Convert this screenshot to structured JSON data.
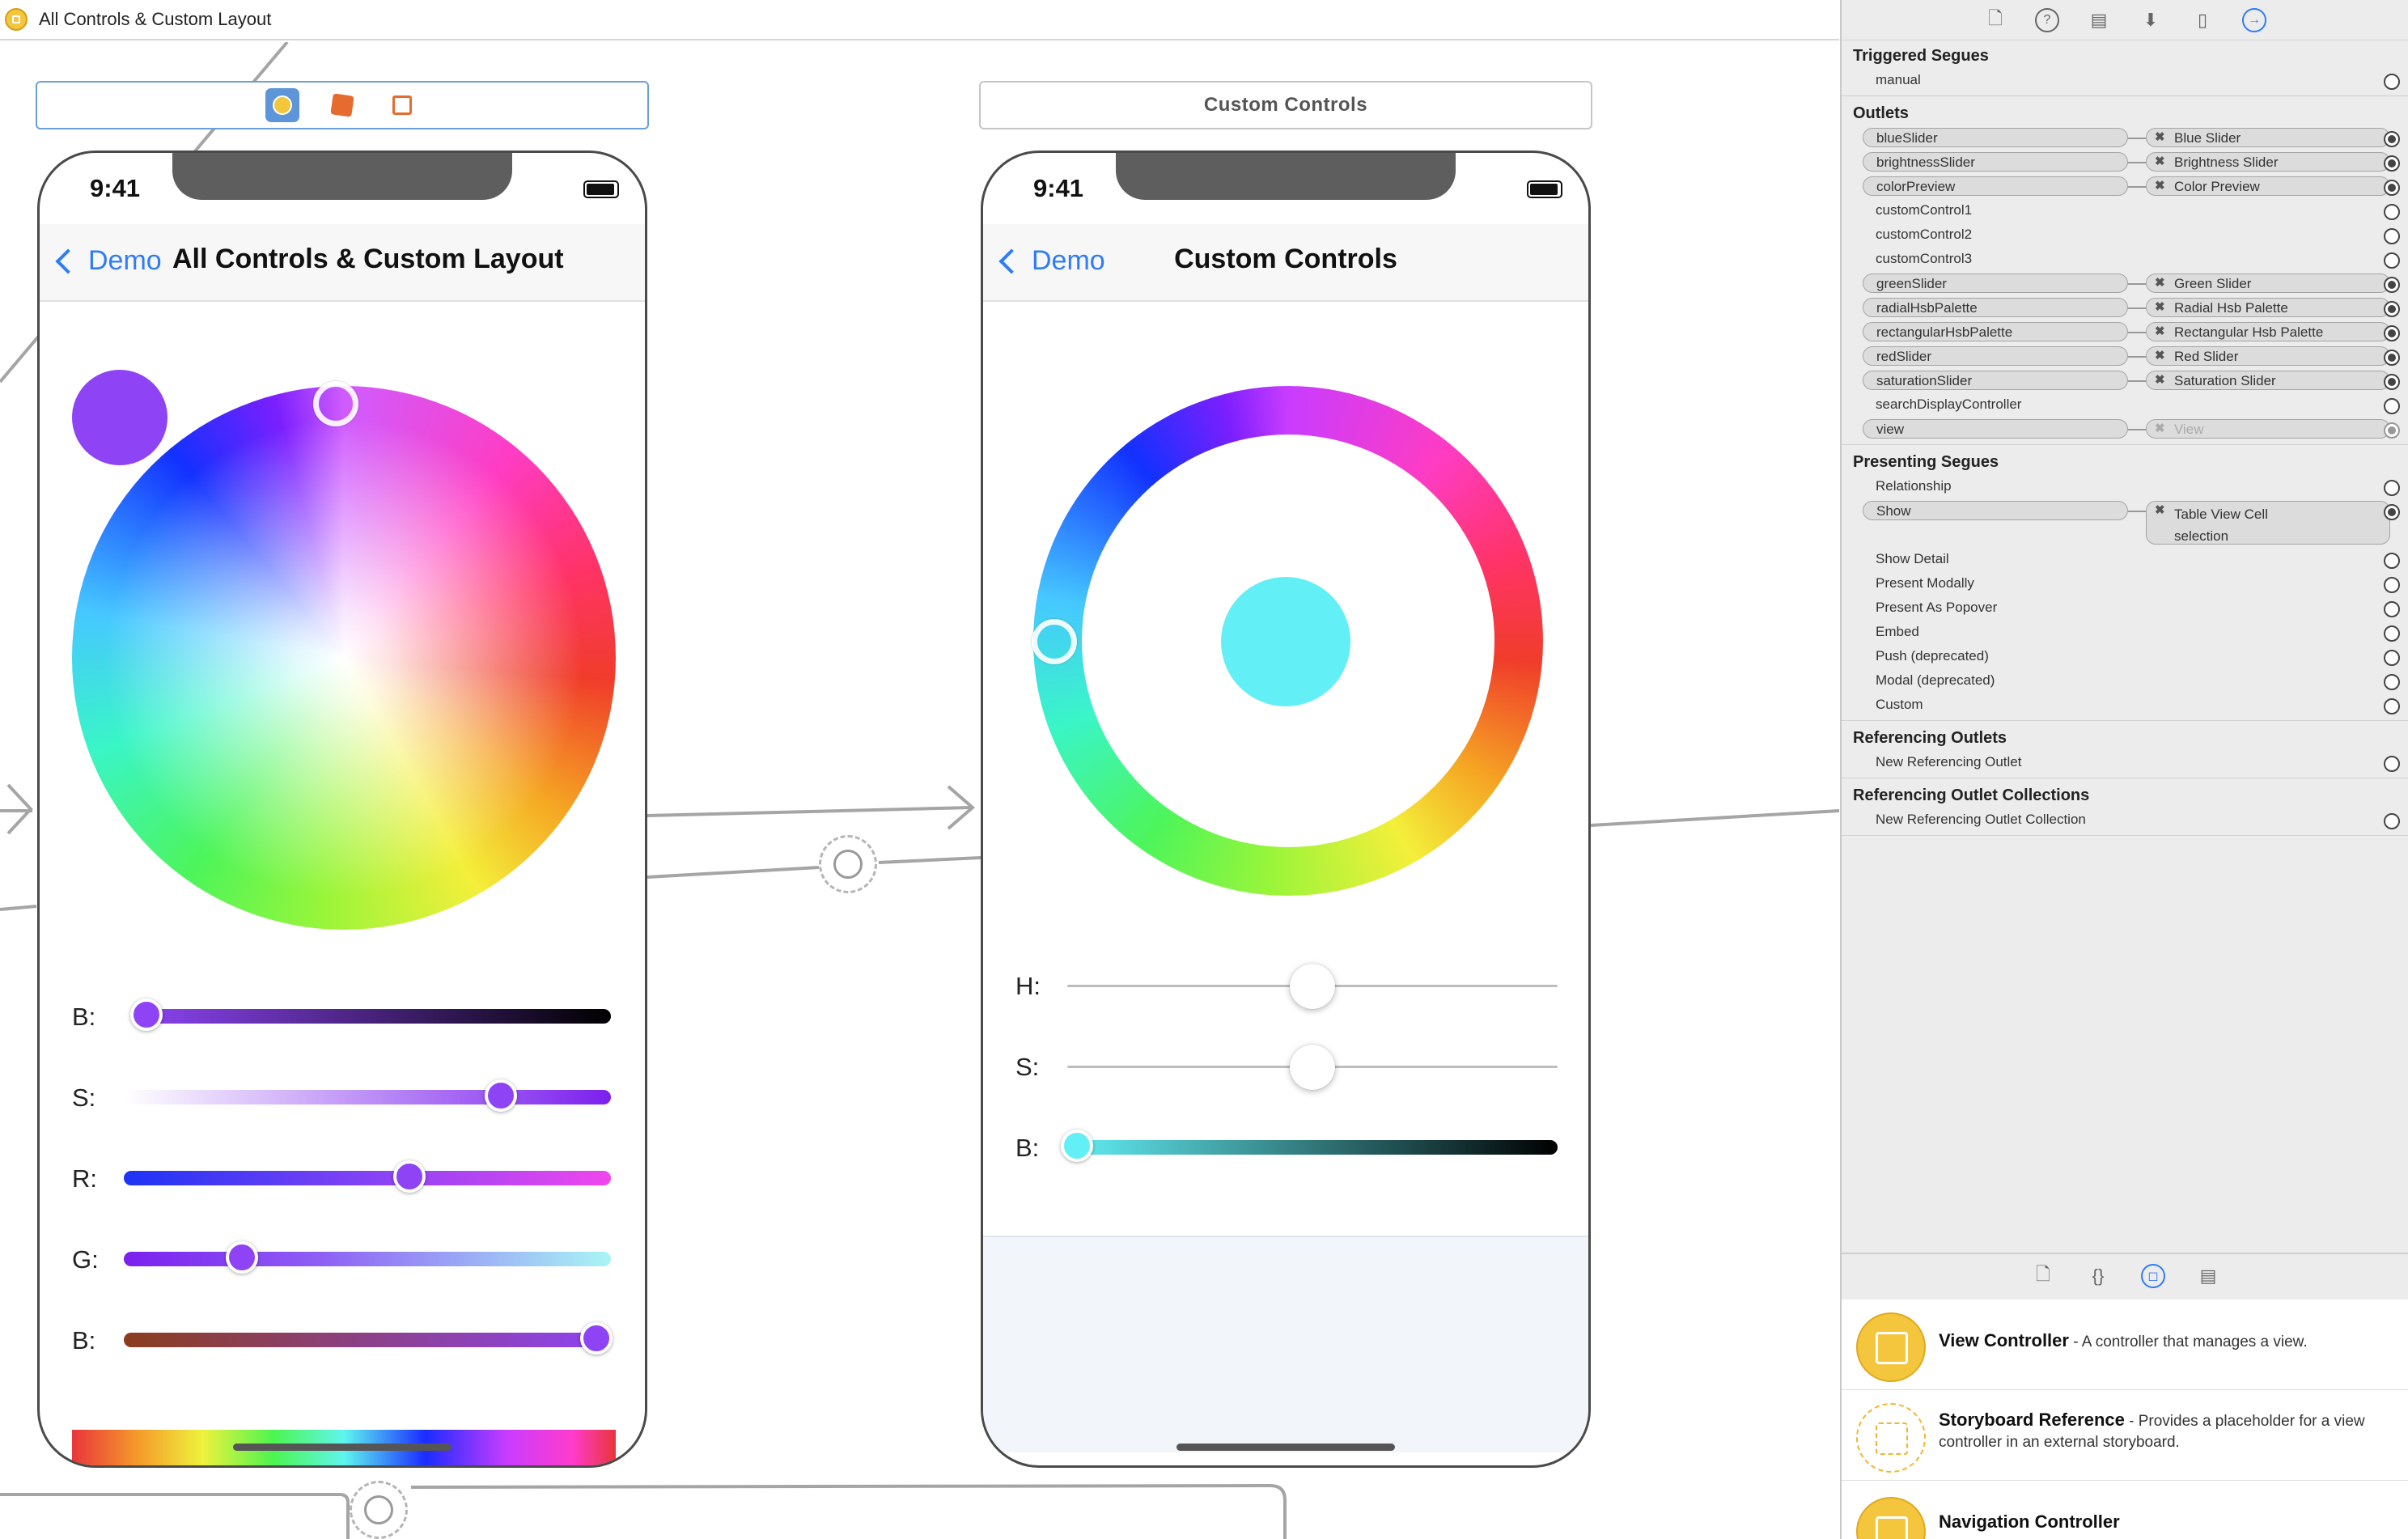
{
  "window": {
    "title": "All Controls & Custom Layout"
  },
  "scene1": {
    "back_label": "Demo",
    "nav_title": "All Controls & Custom Layout",
    "time": "9:41",
    "sliders": [
      {
        "label": "B:",
        "value": 0.03
      },
      {
        "label": "S:",
        "value": 0.77
      },
      {
        "label": "R:",
        "value": 0.58
      },
      {
        "label": "G:",
        "value": 0.23
      },
      {
        "label": "B:",
        "value": 0.97
      }
    ],
    "preview_color": "#8e44f5"
  },
  "scene2": {
    "bar_title": "Custom Controls",
    "back_label": "Demo",
    "nav_title": "Custom Controls",
    "time": "9:41",
    "sliders": [
      {
        "label": "H:",
        "value": 0.5
      },
      {
        "label": "S:",
        "value": 0.5
      },
      {
        "label": "B:",
        "value": 0.02
      }
    ],
    "preview_color": "#62eff5"
  },
  "inspector": {
    "triggered_segues": {
      "title": "Triggered Segues",
      "items": [
        {
          "name": "manual"
        }
      ]
    },
    "outlets": {
      "title": "Outlets",
      "items": [
        {
          "name": "blueSlider",
          "target": "Blue Slider"
        },
        {
          "name": "brightnessSlider",
          "target": "Brightness Slider"
        },
        {
          "name": "colorPreview",
          "target": "Color Preview"
        },
        {
          "name": "customControl1",
          "target": ""
        },
        {
          "name": "customControl2",
          "target": ""
        },
        {
          "name": "customControl3",
          "target": ""
        },
        {
          "name": "greenSlider",
          "target": "Green Slider"
        },
        {
          "name": "radialHsbPalette",
          "target": "Radial Hsb Palette"
        },
        {
          "name": "rectangularHsbPalette",
          "target": "Rectangular Hsb Palette"
        },
        {
          "name": "redSlider",
          "target": "Red Slider"
        },
        {
          "name": "saturationSlider",
          "target": "Saturation Slider"
        },
        {
          "name": "searchDisplayController",
          "target": ""
        },
        {
          "name": "view",
          "target": "View"
        }
      ]
    },
    "presenting_segues": {
      "title": "Presenting Segues",
      "relationship": "Relationship",
      "show": {
        "name": "Show",
        "target_line1": "Table View Cell",
        "target_line2": "selection"
      },
      "items": [
        "Show Detail",
        "Present Modally",
        "Present As Popover",
        "Embed",
        "Push (deprecated)",
        "Modal (deprecated)",
        "Custom"
      ]
    },
    "referencing_outlets": {
      "title": "Referencing Outlets",
      "item": "New Referencing Outlet"
    },
    "referencing_outlet_collections": {
      "title": "Referencing Outlet Collections",
      "item": "New Referencing Outlet Collection"
    }
  },
  "library": {
    "items": [
      {
        "name": "View Controller",
        "desc": " - A controller that manages a view."
      },
      {
        "name": "Storyboard Reference",
        "desc": " - Provides a placeholder for a view controller in an external storyboard."
      },
      {
        "name": "Navigation Controller",
        "desc": ""
      }
    ]
  },
  "colors": {
    "accent": "#2f7cf6",
    "vc_yellow": "#f4c63d"
  }
}
